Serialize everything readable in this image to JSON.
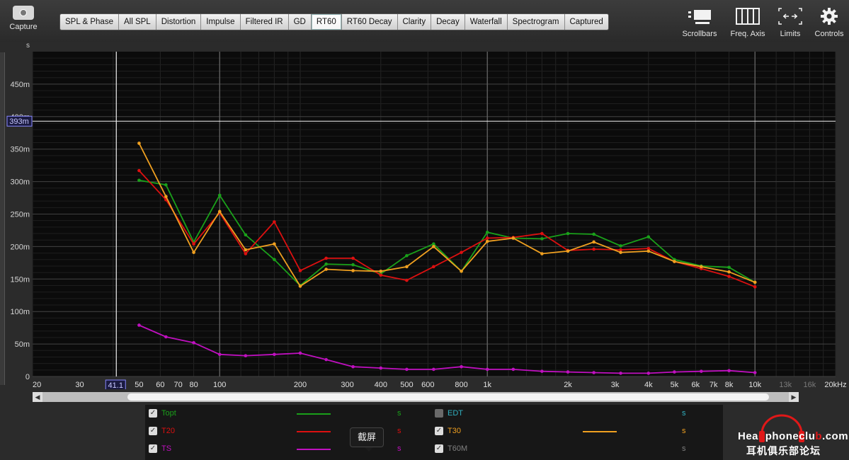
{
  "toolbar": {
    "capture_label": "Capture",
    "tabs": [
      "SPL & Phase",
      "All SPL",
      "Distortion",
      "Impulse",
      "Filtered IR",
      "GD",
      "RT60",
      "RT60 Decay",
      "Clarity",
      "Decay",
      "Waterfall",
      "Spectrogram",
      "Captured"
    ],
    "active_tab": "RT60",
    "tools": {
      "scrollbars": "Scrollbars",
      "freq_axis": "Freq. Axis",
      "limits": "Limits",
      "controls": "Controls"
    }
  },
  "chart_data": {
    "type": "line",
    "ylabel": "s",
    "xlabel": "Hz",
    "x_scale": "log",
    "xlim": [
      20,
      20000
    ],
    "ylim": [
      0,
      0.5
    ],
    "grid": true,
    "y_ticks": [
      0,
      0.05,
      0.1,
      0.15,
      0.2,
      0.25,
      0.3,
      0.35,
      0.4,
      0.45
    ],
    "y_tick_labels": [
      "0",
      "50m",
      "100m",
      "150m",
      "200m",
      "250m",
      "300m",
      "350m",
      "400m",
      "450m"
    ],
    "x_ticks": [
      20,
      30,
      50,
      60,
      70,
      80,
      100,
      200,
      300,
      400,
      500,
      600,
      800,
      1000,
      2000,
      3000,
      4000,
      5000,
      6000,
      7000,
      8000,
      10000,
      13000,
      16000,
      20000
    ],
    "x_tick_labels": [
      "20",
      "30",
      "50",
      "60",
      "70",
      "80",
      "100",
      "200",
      "300",
      "400",
      "500",
      "600",
      "800",
      "1k",
      "2k",
      "3k",
      "4k",
      "5k",
      "6k",
      "7k",
      "8k",
      "10k",
      "13k",
      "16k",
      "20kHz"
    ],
    "dim_ticks": [
      "13k",
      "16k"
    ],
    "cursor": {
      "x": 41.1,
      "x_label": "41.1",
      "y": 0.393,
      "y_label": "393m"
    },
    "x": [
      50,
      63,
      80,
      100,
      125,
      160,
      200,
      250,
      315,
      400,
      500,
      630,
      800,
      1000,
      1250,
      1600,
      2000,
      2500,
      3150,
      4000,
      5000,
      6300,
      8000,
      10000
    ],
    "series": [
      {
        "name": "Topt",
        "color": "#1aa01a",
        "values": [
          0.302,
          0.295,
          0.207,
          0.279,
          0.218,
          0.18,
          0.14,
          0.173,
          0.172,
          0.158,
          0.186,
          0.204,
          0.162,
          0.222,
          0.213,
          0.212,
          0.22,
          0.219,
          0.201,
          0.215,
          0.18,
          0.17,
          0.168,
          0.145
        ]
      },
      {
        "name": "T20",
        "color": "#dd1010",
        "values": [
          0.317,
          0.272,
          0.204,
          0.252,
          0.189,
          0.238,
          0.163,
          0.182,
          0.182,
          0.156,
          0.148,
          0.169,
          0.191,
          0.213,
          0.214,
          0.22,
          0.194,
          0.196,
          0.195,
          0.197,
          0.177,
          0.166,
          0.154,
          0.138
        ]
      },
      {
        "name": "T30",
        "color": "#f0a020",
        "values": [
          0.359,
          0.277,
          0.191,
          0.254,
          0.195,
          0.204,
          0.139,
          0.165,
          0.163,
          0.162,
          0.169,
          0.2,
          0.162,
          0.208,
          0.213,
          0.189,
          0.193,
          0.207,
          0.191,
          0.193,
          0.177,
          0.169,
          0.161,
          0.145
        ]
      },
      {
        "name": "TS",
        "color": "#c010c0",
        "values": [
          0.079,
          0.061,
          0.052,
          0.034,
          0.032,
          0.034,
          0.036,
          0.026,
          0.015,
          0.013,
          0.011,
          0.011,
          0.015,
          0.011,
          0.011,
          0.008,
          0.007,
          0.006,
          0.005,
          0.005,
          0.007,
          0.008,
          0.009,
          0.006
        ]
      }
    ]
  },
  "scrollbar": {
    "left_arrow": "◀",
    "right_arrow": "▶"
  },
  "legend": {
    "rows": [
      {
        "name": "Topt",
        "checked": true,
        "color": "#1aa01a",
        "unit": "s",
        "col": 0,
        "row": 0,
        "line": true
      },
      {
        "name": "T20",
        "checked": true,
        "color": "#dd1010",
        "unit": "s",
        "col": 0,
        "row": 1,
        "line": true
      },
      {
        "name": "TS",
        "checked": true,
        "color": "#c010c0",
        "unit": "s",
        "col": 0,
        "row": 2,
        "line": true
      },
      {
        "name": "EDT",
        "checked": false,
        "color": "#30b0c0",
        "unit": "s",
        "col": 1,
        "row": 0,
        "line": false
      },
      {
        "name": "T30",
        "checked": true,
        "color": "#f0a020",
        "unit": "s",
        "col": 1,
        "row": 1,
        "line": true
      },
      {
        "name": "T60M",
        "checked": true,
        "color": "#808080",
        "unit": "s",
        "col": 1,
        "row": 2,
        "line": false
      }
    ],
    "check_mark": "✓"
  },
  "tooltip": "截屏",
  "watermark": {
    "line1": "HeadphoneClub.com",
    "line2": "耳机俱乐部论坛",
    "line1_display_a": "Hea",
    "line1_display_b": "phoneclu",
    "line1_display_c": ".com"
  }
}
